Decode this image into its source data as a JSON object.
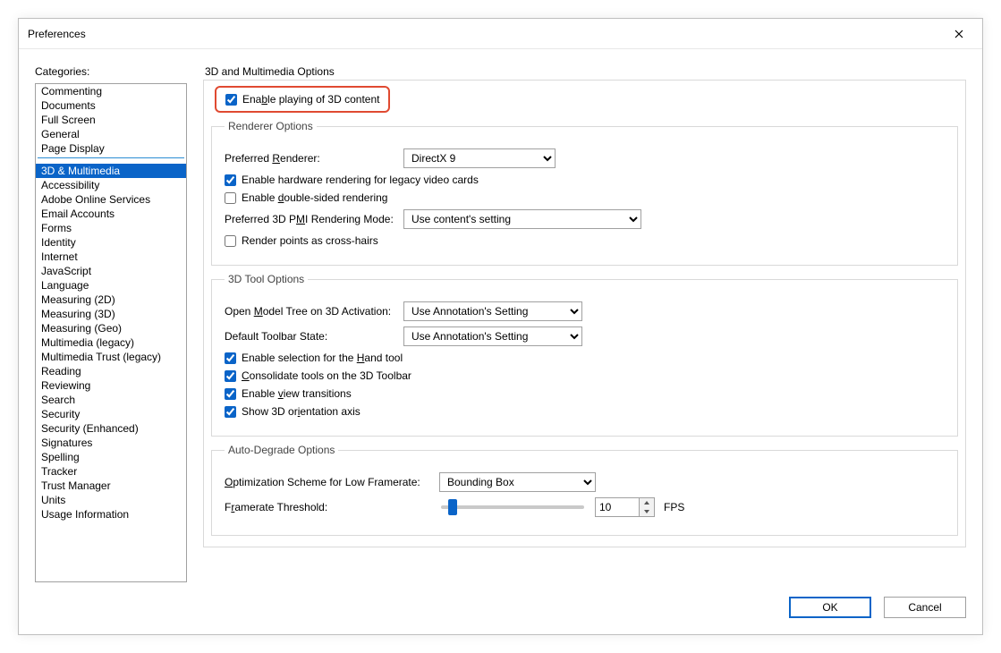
{
  "window": {
    "title": "Preferences"
  },
  "categories": {
    "label": "Categories:",
    "itemsTop": [
      "Commenting",
      "Documents",
      "Full Screen",
      "General",
      "Page Display"
    ],
    "itemsBottom": [
      "3D & Multimedia",
      "Accessibility",
      "Adobe Online Services",
      "Email Accounts",
      "Forms",
      "Identity",
      "Internet",
      "JavaScript",
      "Language",
      "Measuring (2D)",
      "Measuring (3D)",
      "Measuring (Geo)",
      "Multimedia (legacy)",
      "Multimedia Trust (legacy)",
      "Reading",
      "Reviewing",
      "Search",
      "Security",
      "Security (Enhanced)",
      "Signatures",
      "Spelling",
      "Tracker",
      "Trust Manager",
      "Units",
      "Usage Information"
    ],
    "selected": "3D & Multimedia"
  },
  "panel": {
    "title": "3D and Multimedia Options",
    "enable3d": {
      "label": "Enable playing of 3D content",
      "checked": true
    },
    "renderer": {
      "legend": "Renderer Options",
      "preferredRendererLabel": "Preferred Renderer:",
      "preferredRendererValue": "DirectX 9",
      "hwRender": {
        "label": "Enable hardware rendering for legacy video cards",
        "checked": true
      },
      "doubleSided": {
        "label": "Enable double-sided rendering",
        "checked": false
      },
      "pmiLabel": "Preferred 3D PMI Rendering Mode:",
      "pmiValue": "Use content's setting",
      "crosshairs": {
        "label": "Render points as cross-hairs",
        "checked": false
      }
    },
    "tool": {
      "legend": "3D Tool Options",
      "modelTreeLabel": "Open Model Tree on 3D Activation:",
      "modelTreeValue": "Use Annotation's Setting",
      "toolbarStateLabel": "Default Toolbar State:",
      "toolbarStateValue": "Use Annotation's Setting",
      "selHand": {
        "label": "Enable selection for the Hand tool",
        "checked": true
      },
      "consolidate": {
        "label": "Consolidate tools on the 3D Toolbar",
        "checked": true
      },
      "viewTrans": {
        "label": "Enable view transitions",
        "checked": true
      },
      "orientAxis": {
        "label": "Show 3D orientation axis",
        "checked": true
      }
    },
    "auto": {
      "legend": "Auto-Degrade Options",
      "optLabel": "Optimization Scheme for Low Framerate:",
      "optValue": "Bounding Box",
      "thresholdLabel": "Framerate Threshold:",
      "thresholdValue": "10",
      "thresholdSlider": 5,
      "unit": "FPS"
    }
  },
  "buttons": {
    "ok": "OK",
    "cancel": "Cancel"
  }
}
